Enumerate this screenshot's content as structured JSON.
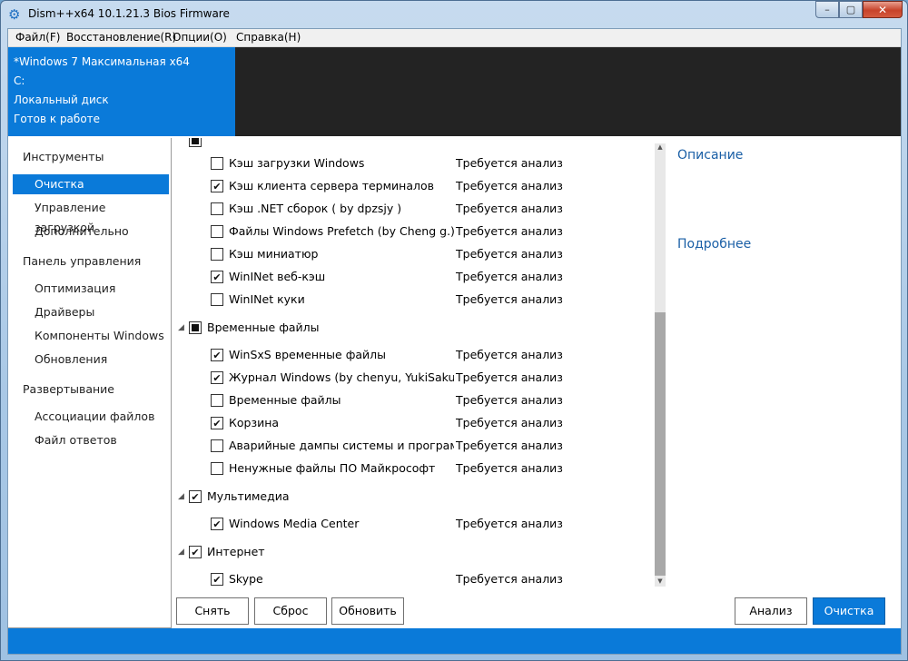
{
  "window": {
    "title": "Dism++x64 10.1.21.3 Bios Firmware",
    "minimize": "–",
    "maximize": "▢",
    "close": "✕"
  },
  "menu": [
    "Файл(F)",
    "Восстановление(R)",
    "Опции(O)",
    "Справка(H)"
  ],
  "system_info": {
    "os": "*Windows 7 Максимальная x64",
    "drive": "C:",
    "disk": "Локальный диск",
    "status": "Готов к работе"
  },
  "sidebar": {
    "sections": [
      {
        "title": "Инструменты",
        "items": [
          "Очистка",
          "Управление загрузкой",
          "Дополнительно"
        ]
      },
      {
        "title": "Панель управления",
        "items": [
          "Оптимизация",
          "Драйверы",
          "Компоненты Windows",
          "Обновления"
        ]
      },
      {
        "title": "Развертывание",
        "items": [
          "Ассоциации файлов",
          "Файл ответов"
        ]
      }
    ],
    "active_item": "Очистка"
  },
  "cleanup_list": {
    "groups": [
      {
        "name": "",
        "state": "partial",
        "items": [
          {
            "name": "Кэш загрузки Windows",
            "checked": false,
            "status": "Требуется анализ"
          },
          {
            "name": "Кэш клиента сервера терминалов",
            "checked": true,
            "status": "Требуется анализ"
          },
          {
            "name": "Кэш .NET сборок ( by dpzsjy )",
            "checked": false,
            "status": "Требуется анализ"
          },
          {
            "name": "Файлы Windows Prefetch (by Cheng g.)",
            "checked": false,
            "status": "Требуется анализ"
          },
          {
            "name": "Кэш миниатюр",
            "checked": false,
            "status": "Требуется анализ"
          },
          {
            "name": "WinINet веб-кэш",
            "checked": true,
            "status": "Требуется анализ"
          },
          {
            "name": "WinINet куки",
            "checked": false,
            "status": "Требуется анализ"
          }
        ]
      },
      {
        "name": "Временные файлы",
        "state": "partial",
        "items": [
          {
            "name": "WinSxS временные файлы",
            "checked": true,
            "status": "Требуется анализ"
          },
          {
            "name": "Журнал Windows (by chenyu, YukiSakura)",
            "checked": true,
            "status": "Требуется анализ"
          },
          {
            "name": "Временные файлы",
            "checked": false,
            "status": "Требуется анализ"
          },
          {
            "name": "Корзина",
            "checked": true,
            "status": "Требуется анализ"
          },
          {
            "name": "Аварийные дампы системы и программ (Пользовательские)",
            "checked": false,
            "status": "Требуется анализ"
          },
          {
            "name": "Ненужные файлы ПО Майкрософт",
            "checked": false,
            "status": "Требуется анализ"
          }
        ]
      },
      {
        "name": "Мультимедиа",
        "state": "checked",
        "items": [
          {
            "name": "Windows Media Center",
            "checked": true,
            "status": "Требуется анализ"
          }
        ]
      },
      {
        "name": "Интернет",
        "state": "checked",
        "items": [
          {
            "name": "Skype",
            "checked": true,
            "status": "Требуется анализ"
          }
        ]
      }
    ]
  },
  "description_panel": {
    "title": "Описание",
    "more": "Подробнее"
  },
  "buttons": {
    "deselect": "Снять",
    "reset": "Сброс",
    "refresh": "Обновить",
    "analyze": "Анализ",
    "clean": "Очистка"
  },
  "colors": {
    "accent": "#0a7ad9",
    "header_dark": "#232323",
    "link": "#1a5fa6"
  }
}
